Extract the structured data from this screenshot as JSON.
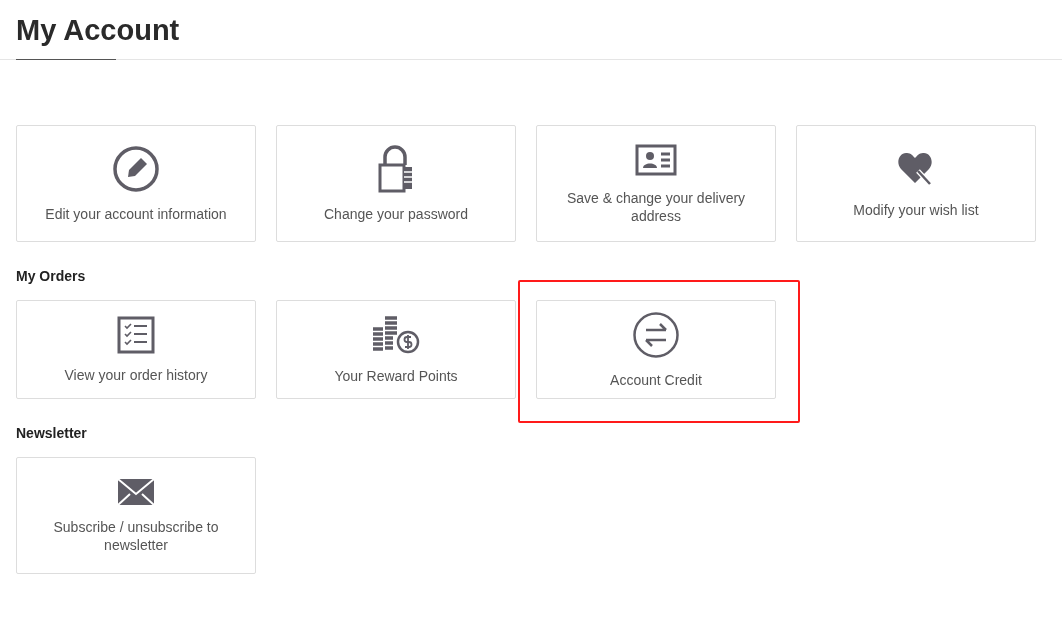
{
  "page_title": "My Account",
  "sections": [
    {
      "cards": [
        {
          "kind": "pencil",
          "label": "Edit your account information",
          "highlighted": false
        },
        {
          "kind": "lock",
          "label": "Change your password",
          "highlighted": false
        },
        {
          "kind": "idcard",
          "label": "Save & change your delivery address",
          "highlighted": false
        },
        {
          "kind": "heart",
          "label": "Modify your wish list",
          "highlighted": false
        }
      ]
    },
    {
      "heading": "My Orders",
      "cards": [
        {
          "kind": "checklist",
          "label": "View your order history",
          "highlighted": false
        },
        {
          "kind": "coins",
          "label": "Your Reward Points",
          "highlighted": false
        },
        {
          "kind": "exchange",
          "label": "Account Credit",
          "highlighted": true
        }
      ]
    },
    {
      "heading": "Newsletter",
      "cards": [
        {
          "kind": "envelope",
          "label": "Subscribe / unsubscribe to newsletter",
          "highlighted": false
        }
      ]
    }
  ]
}
